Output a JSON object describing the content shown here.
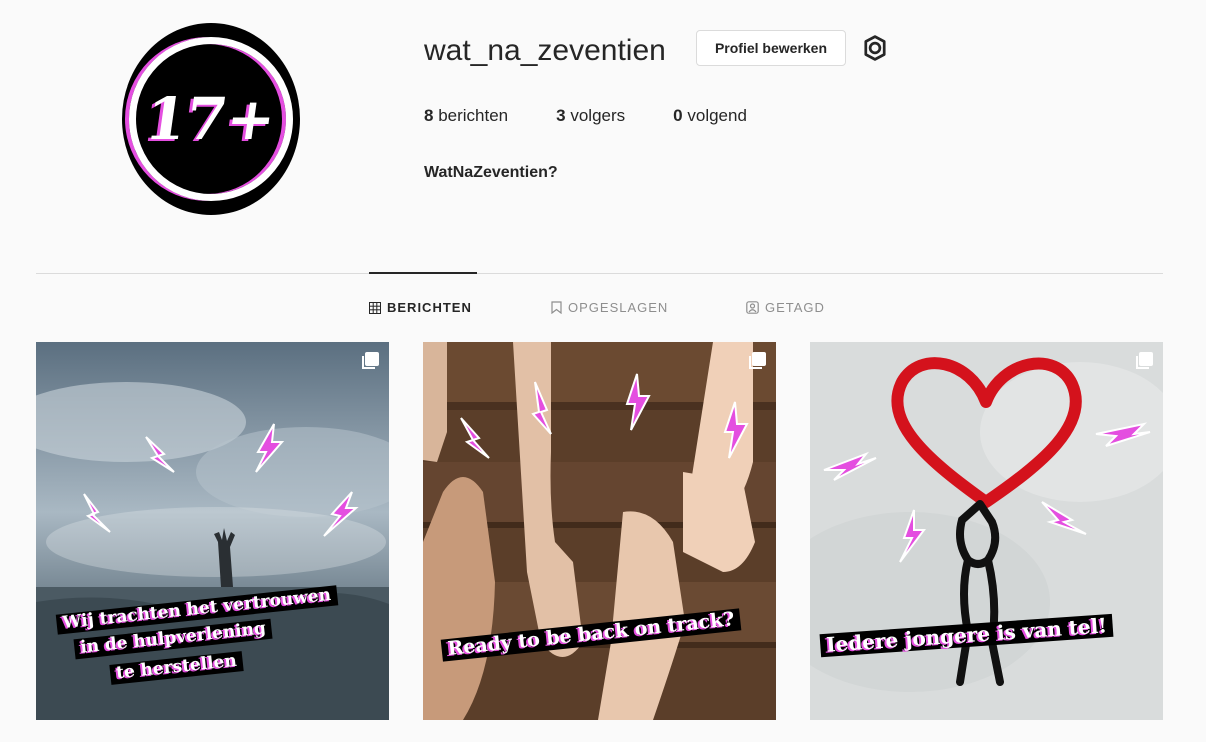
{
  "profile": {
    "username": "wat_na_zeventien",
    "edit_label": "Profiel bewerken",
    "avatar_text": "17+",
    "full_name": "WatNaZeventien?",
    "stats": [
      {
        "count": "8",
        "label": "berichten"
      },
      {
        "count": "3",
        "label": "volgers"
      },
      {
        "count": "0",
        "label": "volgend"
      }
    ]
  },
  "tabs": [
    {
      "label": "BERICHTEN",
      "icon": "grid-icon",
      "active": true
    },
    {
      "label": "OPGESLAGEN",
      "icon": "bookmark-icon",
      "active": false
    },
    {
      "label": "GETAGD",
      "icon": "tag-person-icon",
      "active": false
    }
  ],
  "posts": [
    {
      "caption_lines": [
        "Wij trachten het vertrouwen",
        "in de hulpverlening",
        "te herstellen"
      ],
      "icon": "multiple-posts-icon"
    },
    {
      "caption_lines": [
        "Ready to be back on track?"
      ],
      "icon": "multiple-posts-icon"
    },
    {
      "caption_lines": [
        "Iedere jongere is van tel!"
      ],
      "icon": "multiple-posts-icon"
    }
  ],
  "colors": {
    "accent": "#e44ee0",
    "border": "#dbdbdb",
    "text": "#262626",
    "muted": "#8e8e8e"
  }
}
